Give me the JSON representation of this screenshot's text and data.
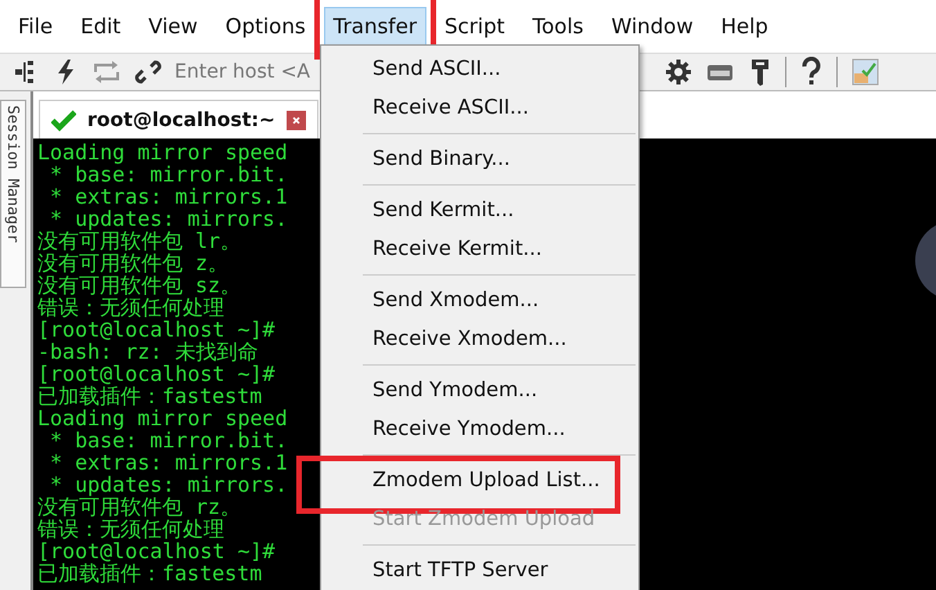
{
  "menubar": [
    {
      "label": "File",
      "selected": false,
      "highlighted": false
    },
    {
      "label": "Edit",
      "selected": false,
      "highlighted": false
    },
    {
      "label": "View",
      "selected": false,
      "highlighted": false
    },
    {
      "label": "Options",
      "selected": false,
      "highlighted": false
    },
    {
      "label": "Transfer",
      "selected": true,
      "highlighted": true
    },
    {
      "label": "Script",
      "selected": false,
      "highlighted": false
    },
    {
      "label": "Tools",
      "selected": false,
      "highlighted": false
    },
    {
      "label": "Window",
      "selected": false,
      "highlighted": false
    },
    {
      "label": "Help",
      "selected": false,
      "highlighted": false
    }
  ],
  "toolbar": {
    "host_field": {
      "placeholder": "Enter host <A"
    }
  },
  "side_tab": {
    "label": "Session Manager"
  },
  "session_tab": {
    "label": "root@localhost:~",
    "connected": true
  },
  "terminal": {
    "lines": [
      "Loading mirror speed",
      " * base: mirror.bit.",
      " * extras: mirrors.1",
      " * updates: mirrors.",
      "没有可用软件包 lr。",
      "没有可用软件包 z。",
      "没有可用软件包 sz。",
      "错误：无须任何处理",
      "[root@localhost ~]#",
      "-bash: rz: 未找到命",
      "[root@localhost ~]#",
      "已加载插件：fastestm",
      "Loading mirror speed",
      " * base: mirror.bit.",
      " * extras: mirrors.1",
      " * updates: mirrors.",
      "没有可用软件包 rz。",
      "错误：无须任何处理",
      "[root@localhost ~]#",
      "已加载插件：fastestm"
    ]
  },
  "transfer_menu": [
    {
      "kind": "item",
      "label": "Send ASCII...",
      "disabled": false,
      "highlighted": false
    },
    {
      "kind": "item",
      "label": "Receive ASCII...",
      "disabled": false,
      "highlighted": false
    },
    {
      "kind": "separator"
    },
    {
      "kind": "item",
      "label": "Send Binary...",
      "disabled": false,
      "highlighted": false
    },
    {
      "kind": "separator"
    },
    {
      "kind": "item",
      "label": "Send Kermit...",
      "disabled": false,
      "highlighted": false
    },
    {
      "kind": "item",
      "label": "Receive Kermit...",
      "disabled": false,
      "highlighted": false
    },
    {
      "kind": "separator"
    },
    {
      "kind": "item",
      "label": "Send Xmodem...",
      "disabled": false,
      "highlighted": false
    },
    {
      "kind": "item",
      "label": "Receive Xmodem...",
      "disabled": false,
      "highlighted": false
    },
    {
      "kind": "separator"
    },
    {
      "kind": "item",
      "label": "Send Ymodem...",
      "disabled": false,
      "highlighted": false
    },
    {
      "kind": "item",
      "label": "Receive Ymodem...",
      "disabled": false,
      "highlighted": false
    },
    {
      "kind": "separator"
    },
    {
      "kind": "item",
      "label": "Zmodem Upload List...",
      "disabled": false,
      "highlighted": true
    },
    {
      "kind": "item",
      "label": "Start Zmodem Upload",
      "disabled": true,
      "highlighted": false
    },
    {
      "kind": "separator"
    },
    {
      "kind": "item",
      "label": "Start TFTP Server",
      "disabled": false,
      "highlighted": false
    }
  ]
}
